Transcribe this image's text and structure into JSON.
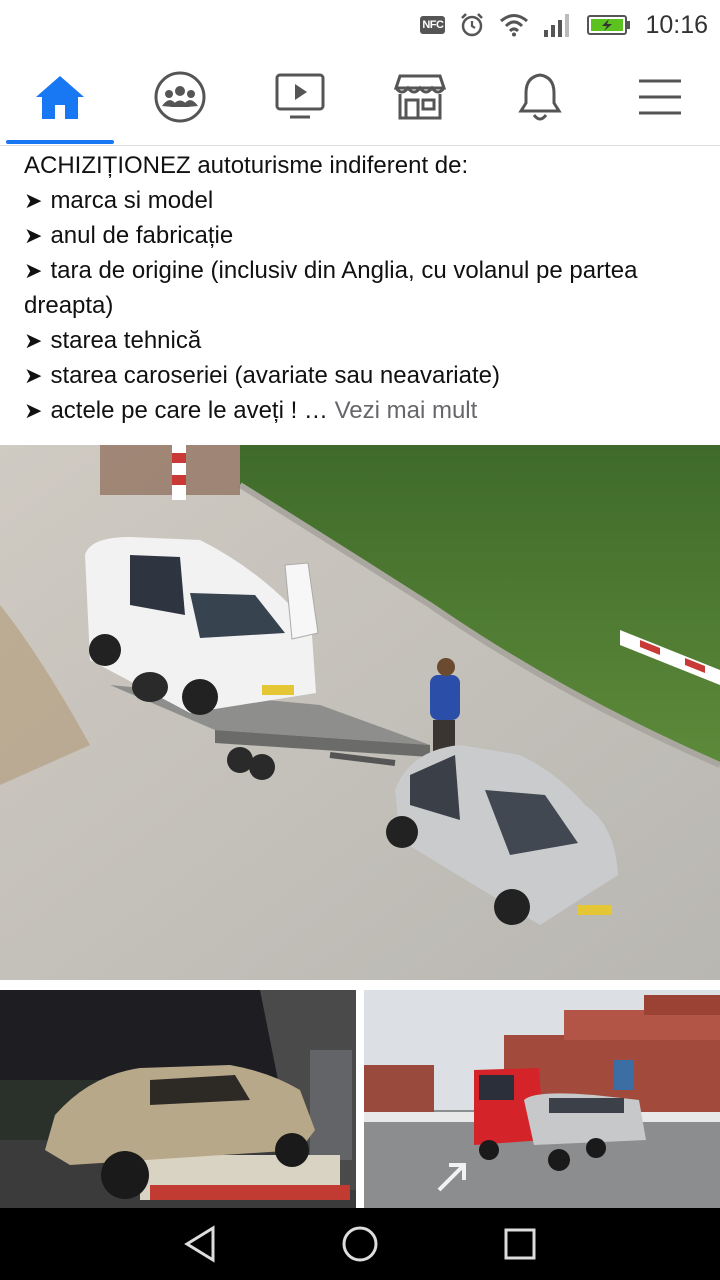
{
  "status_bar": {
    "time": "10:16",
    "nfc": "NFC",
    "icons": [
      "nfc-icon",
      "alarm-icon",
      "wifi-icon",
      "signal-icon",
      "battery-charging-icon"
    ],
    "battery_color": "#5cc21f"
  },
  "nav": {
    "tabs": [
      {
        "name": "home",
        "icon": "home-icon",
        "active": true
      },
      {
        "name": "groups",
        "icon": "groups-icon",
        "active": false
      },
      {
        "name": "watch",
        "icon": "video-icon",
        "active": false
      },
      {
        "name": "marketplace",
        "icon": "marketplace-icon",
        "active": false
      },
      {
        "name": "notifications",
        "icon": "bell-icon",
        "active": false
      },
      {
        "name": "menu",
        "icon": "hamburger-menu-icon",
        "active": false
      }
    ],
    "accent_color": "#1877f2"
  },
  "post": {
    "intro": "ACHIZIȚIONEZ autoturisme indiferent de:",
    "bullet": "➤",
    "items": [
      "marca si model",
      "anul de fabricație",
      "tara de origine (inclusiv din Anglia, cu volanul pe partea dreapta)",
      "starea tehnică",
      "starea caroseriei (avariate sau neavariate)",
      "actele pe care le aveți ! …"
    ],
    "see_more": "Vezi mai mult"
  },
  "photos": [
    {
      "name": "photo-van-trailer-loading"
    },
    {
      "name": "photo-sedan-on-truck-night"
    },
    {
      "name": "photo-minivan-on-red-truck-containers"
    }
  ],
  "system_nav": [
    "back-icon",
    "home-circle-icon",
    "recents-icon"
  ]
}
